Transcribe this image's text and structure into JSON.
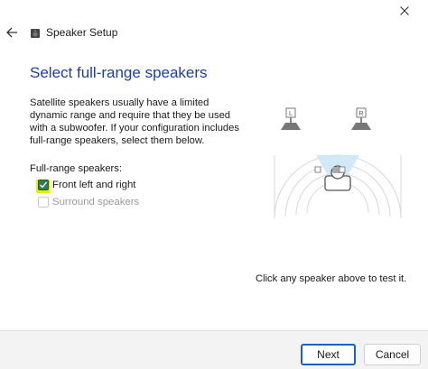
{
  "window": {
    "title": "Speaker Setup"
  },
  "icons": {
    "back": "back-arrow-icon",
    "app": "speaker-icon",
    "close": "close-icon"
  },
  "main": {
    "heading": "Select full-range speakers",
    "description": "Satellite speakers usually have a limited dynamic range and require that they be used with a subwoofer.  If your configuration includes full-range speakers, select them below.",
    "section_label": "Full-range speakers:",
    "options": [
      {
        "label": "Front left and right",
        "checked": true,
        "enabled": true
      },
      {
        "label": "Surround speakers",
        "checked": false,
        "enabled": false
      }
    ],
    "hint": "Click any speaker above to test it."
  },
  "diagram": {
    "left_speaker_label": "L",
    "right_speaker_label": "R"
  },
  "footer": {
    "next_label": "Next",
    "cancel_label": "Cancel"
  },
  "colors": {
    "heading": "#1f3f99",
    "checkbox_checked": "#2e7d4f",
    "highlight": "#e6f000",
    "primary_button_border": "#1f5fbf"
  }
}
